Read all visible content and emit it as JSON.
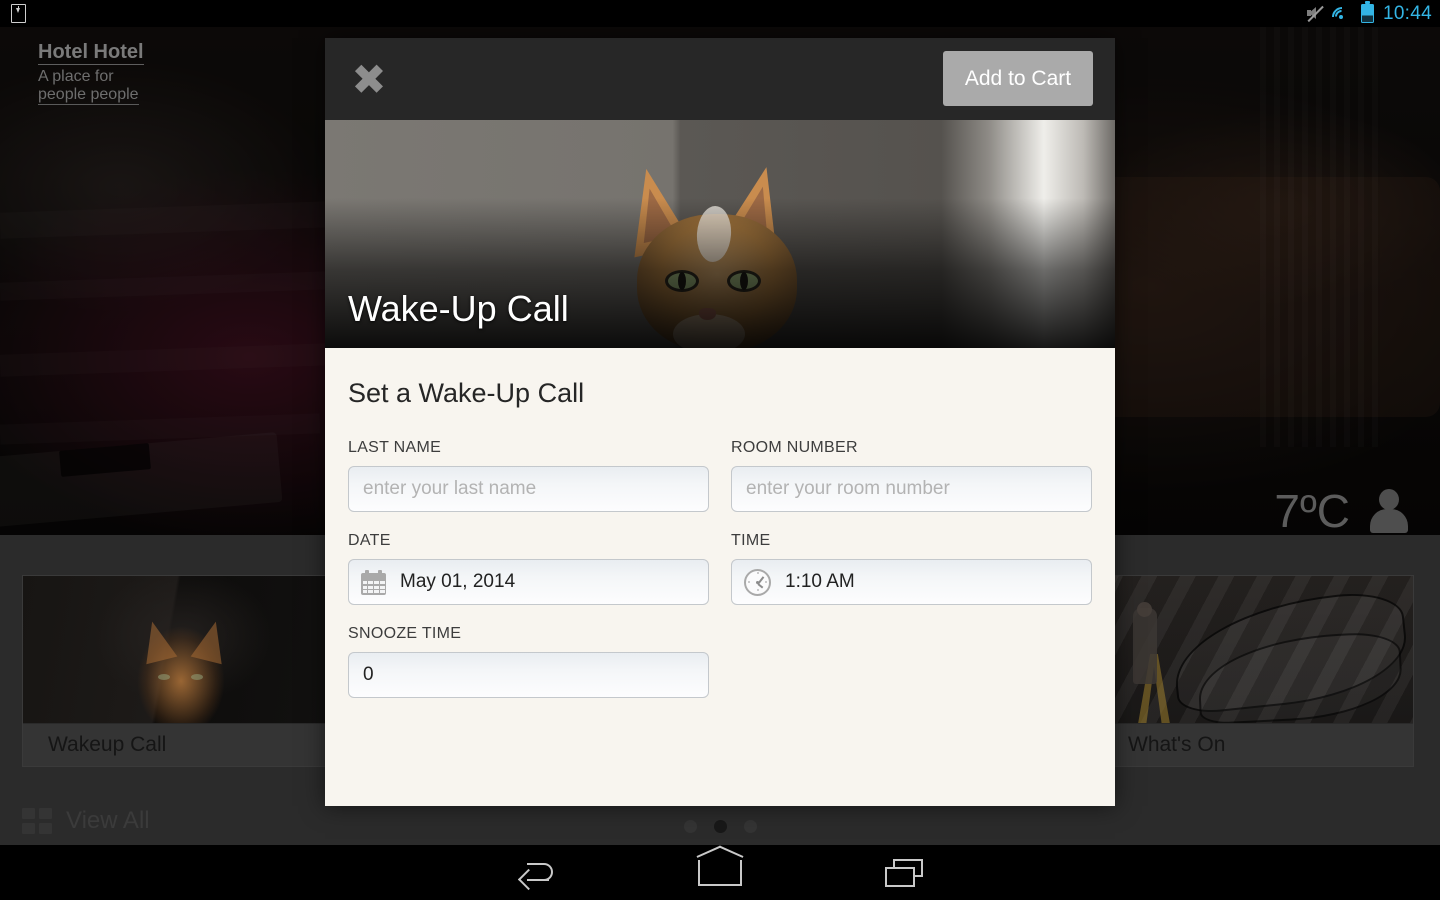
{
  "statusbar": {
    "time": "10:44",
    "icons": [
      "notification-icon",
      "mute-icon",
      "wifi-icon",
      "battery-icon"
    ]
  },
  "background_app": {
    "brand": {
      "title": "Hotel Hotel",
      "subtitle_line1": "A place for",
      "subtitle_line2": "people people"
    },
    "weather": {
      "temperature": "7ºC",
      "avatar_icon": "person-icon"
    },
    "cards": [
      {
        "title": "Wakeup Call",
        "image": "cat-photo"
      },
      {
        "title": "",
        "image": ""
      },
      {
        "title": "",
        "image": ""
      },
      {
        "title": "What's On",
        "image": "mural-photo"
      }
    ],
    "view_all": {
      "label": "View All",
      "icon": "grid-icon"
    },
    "pager": {
      "dots": 3,
      "active_index": 1
    }
  },
  "modal": {
    "close_icon": "close-icon",
    "add_to_cart_label": "Add to Cart",
    "hero_title": "Wake-Up Call",
    "form": {
      "title": "Set a Wake-Up Call",
      "fields": [
        {
          "label": "LAST NAME",
          "value": "",
          "placeholder": "enter your last name",
          "icon": null
        },
        {
          "label": "ROOM NUMBER",
          "value": "",
          "placeholder": "enter your room number",
          "icon": null
        },
        {
          "label": "DATE",
          "value": "May 01, 2014",
          "placeholder": "",
          "icon": "calendar-icon"
        },
        {
          "label": "TIME",
          "value": "1:10 AM",
          "placeholder": "",
          "icon": "clock-icon"
        },
        {
          "label": "SNOOZE TIME",
          "value": "0",
          "placeholder": "",
          "icon": null
        }
      ]
    }
  },
  "navbar": {
    "back_icon": "back-icon",
    "home_icon": "home-icon",
    "recent_icon": "recent-apps-icon"
  },
  "colors": {
    "accent": "#33b5e5",
    "modal_header": "#272727",
    "form_background": "#f8f5ef",
    "cart_button": "#aaaaaa"
  }
}
